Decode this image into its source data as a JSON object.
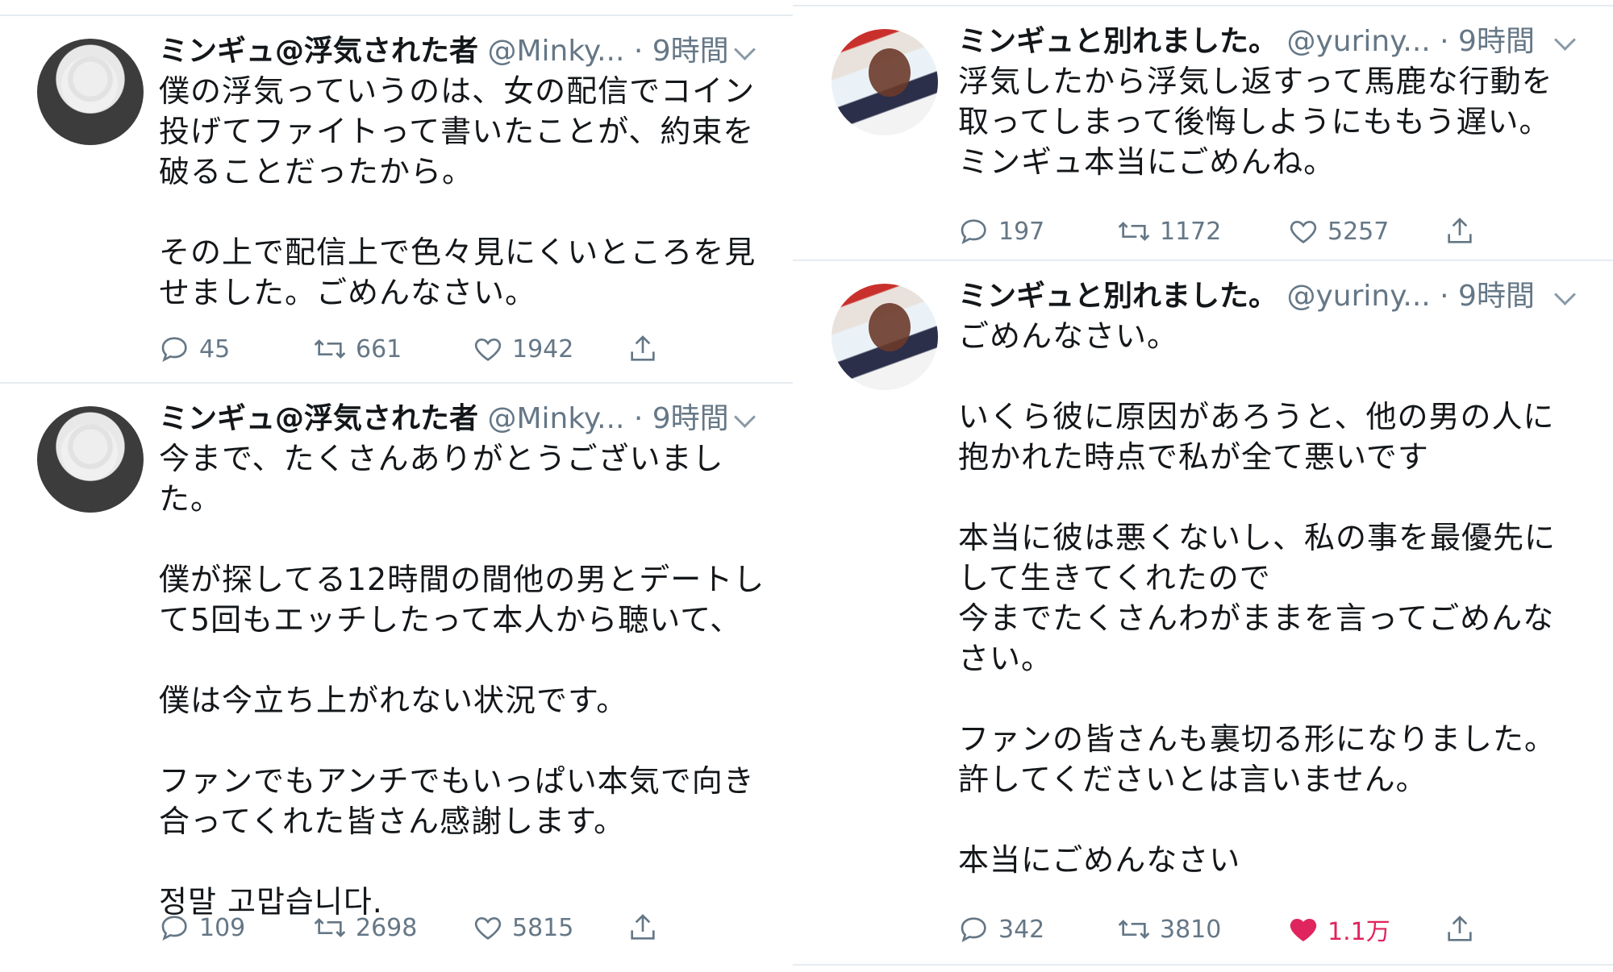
{
  "tweets": [
    {
      "name": "ミンギュ@浮気された者",
      "handle": "@Minky...",
      "time": "· 9時間",
      "body": "僕の浮気っていうのは、女の配信でコイン\n投げてファイトって書いたことが、約束を\n破ることだったから。\n\nその上で配信上で色々見にくいところを見\nせました。ごめんなさい。",
      "reply": "45",
      "retweet": "661",
      "like": "1942",
      "liked": false
    },
    {
      "name": "ミンギュ@浮気された者",
      "handle": "@Minky...",
      "time": "· 9時間",
      "body": "今まで、たくさんありがとうございまし\nた。\n\n僕が探してる12時間の間他の男とデートし\nて5回もエッチしたって本人から聴いて、\n\n僕は今立ち上がれない状況です。\n\nファンでもアンチでもいっぱい本気で向き\n合ってくれた皆さん感謝します。\n\n정말 고맙습니다.",
      "reply": "109",
      "retweet": "2698",
      "like": "5815",
      "liked": false
    },
    {
      "name": "ミンギュと別れました。",
      "handle": "@yuriny...",
      "time": "· 9時間",
      "body": "浮気したから浮気し返すって馬鹿な行動を\n取ってしまって後悔しようにももう遅い。\nミンギュ本当にごめんね。",
      "reply": "197",
      "retweet": "1172",
      "like": "5257",
      "liked": false
    },
    {
      "name": "ミンギュと別れました。",
      "handle": "@yuriny...",
      "time": "· 9時間",
      "body": "ごめんなさい。\n\nいくら彼に原因があろうと、他の男の人に\n抱かれた時点で私が全て悪いです\n\n本当に彼は悪くないし、私の事を最優先に\nして生きてくれたので\n今までたくさんわがままを言ってごめんな\nさい。\n\nファンの皆さんも裏切る形になりました。\n許してくださいとは言いません。\n\n本当にごめんなさい",
      "reply": "342",
      "retweet": "3810",
      "like": "1.1万",
      "liked": true
    }
  ],
  "colors": {
    "muted": "#657786",
    "text": "#14171a",
    "like_active": "#e0245e",
    "divider": "#e6ecf0"
  },
  "icons": [
    "reply-icon",
    "retweet-icon",
    "like-icon",
    "share-icon",
    "chevron-down-icon"
  ]
}
